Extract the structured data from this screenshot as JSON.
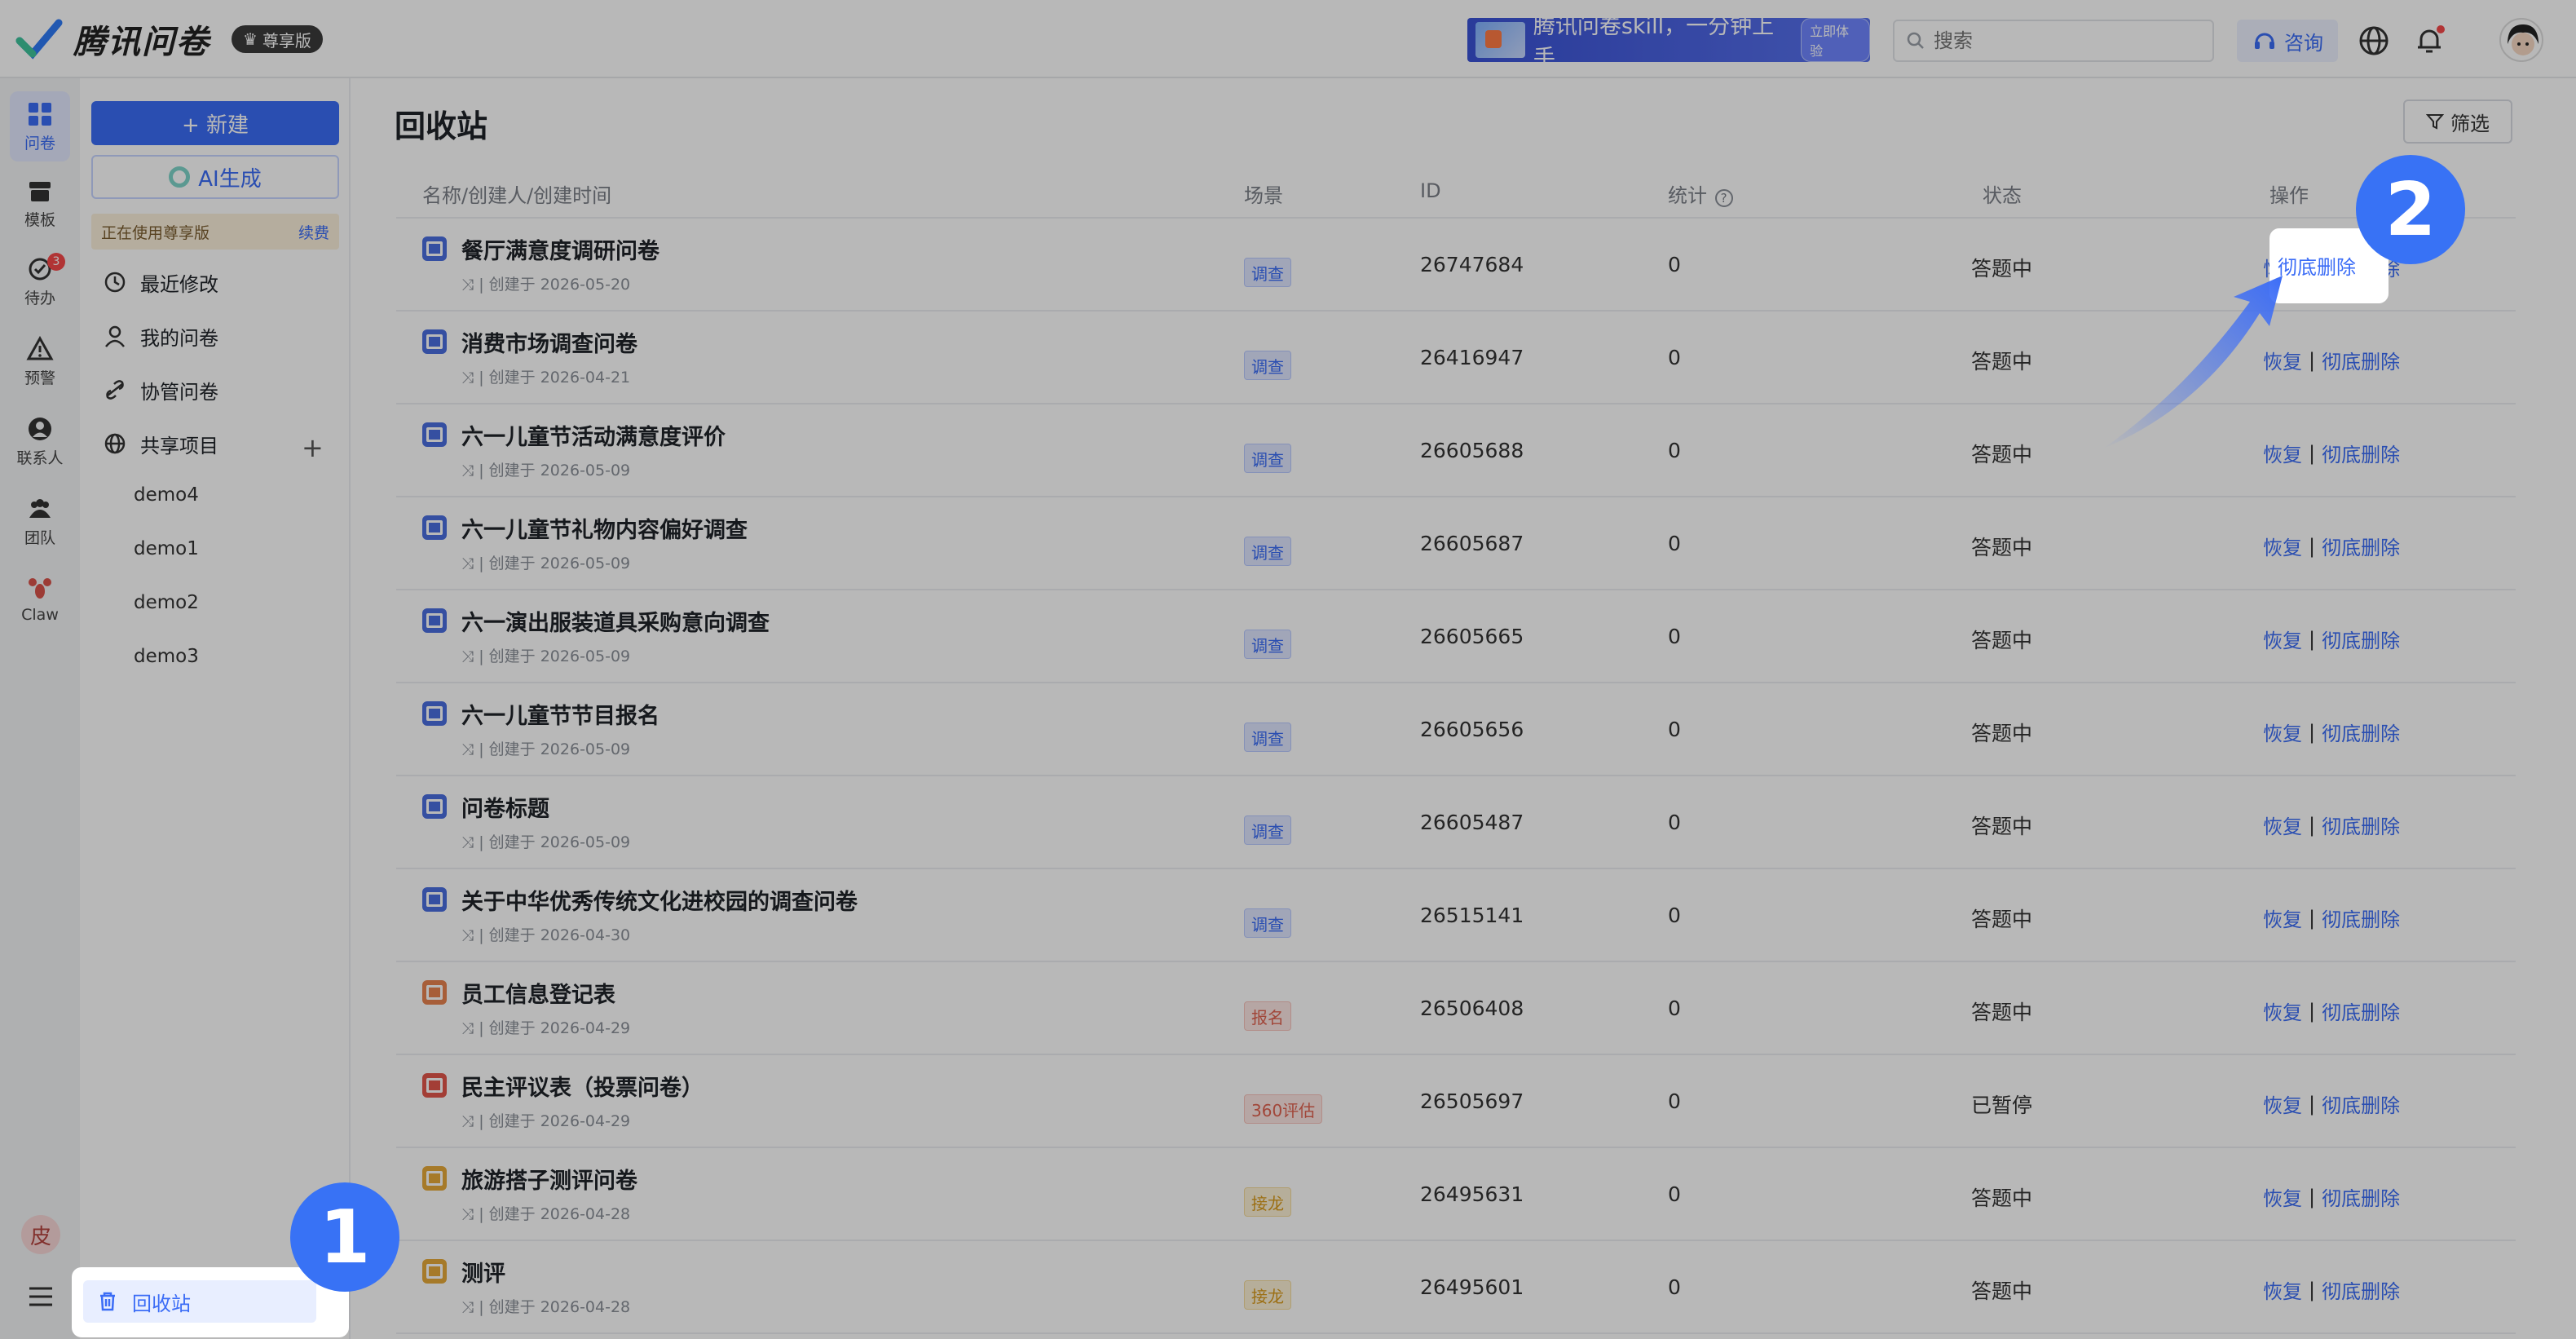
{
  "header": {
    "app_name": "腾讯问卷",
    "vip_badge": "尊享版",
    "promo_text": "腾讯问卷skill，一分钟上手",
    "promo_button": "立即体验",
    "search_placeholder": "搜索",
    "consult_label": "咨询"
  },
  "rail": {
    "items": [
      {
        "label": "问卷",
        "icon": "grid-icon"
      },
      {
        "label": "模板",
        "icon": "template-icon"
      },
      {
        "label": "待办",
        "icon": "check-circle-icon",
        "badge": "3"
      },
      {
        "label": "预警",
        "icon": "warning-icon"
      },
      {
        "label": "联系人",
        "icon": "contact-icon"
      },
      {
        "label": "团队",
        "icon": "team-icon"
      },
      {
        "label": "Claw",
        "icon": "lobster-icon"
      }
    ],
    "user_initial": "皮"
  },
  "leftnav": {
    "new_button": "+ 新建",
    "ai_button": "AI生成",
    "vip_text": "正在使用尊享版",
    "renew": "续费",
    "items": [
      {
        "label": "最近修改"
      },
      {
        "label": "我的问卷"
      },
      {
        "label": "协管问卷"
      },
      {
        "label": "共享项目"
      }
    ],
    "projects": [
      "demo4",
      "demo1",
      "demo2",
      "demo3"
    ],
    "recycle": "回收站"
  },
  "main": {
    "title": "回收站",
    "filter": "筛选",
    "columns": {
      "name": "名称/创建人/创建时间",
      "scene": "场景",
      "id": "ID",
      "stats": "统计",
      "status": "状态",
      "ops": "操作"
    },
    "op_restore": "恢复",
    "op_delete": "彻底删除",
    "rows": [
      {
        "name": "餐厅满意度调研问卷",
        "meta": "⤨ | 创建于 2026-05-20",
        "scene": "调查",
        "scene_type": "survey",
        "id": "26747684",
        "stats": "0",
        "status": "答题中"
      },
      {
        "name": "消费市场调查问卷",
        "meta": "⤨ | 创建于 2026-04-21",
        "scene": "调查",
        "scene_type": "survey",
        "id": "26416947",
        "stats": "0",
        "status": "答题中"
      },
      {
        "name": "六一儿童节活动满意度评价",
        "meta": "⤨ | 创建于 2026-05-09",
        "scene": "调查",
        "scene_type": "survey",
        "id": "26605688",
        "stats": "0",
        "status": "答题中"
      },
      {
        "name": "六一儿童节礼物内容偏好调查",
        "meta": "⤨ | 创建于 2026-05-09",
        "scene": "调查",
        "scene_type": "survey",
        "id": "26605687",
        "stats": "0",
        "status": "答题中"
      },
      {
        "name": "六一演出服装道具采购意向调查",
        "meta": "⤨ | 创建于 2026-05-09",
        "scene": "调查",
        "scene_type": "survey",
        "id": "26605665",
        "stats": "0",
        "status": "答题中"
      },
      {
        "name": "六一儿童节节目报名",
        "meta": "⤨ | 创建于 2026-05-09",
        "scene": "调查",
        "scene_type": "survey",
        "id": "26605656",
        "stats": "0",
        "status": "答题中"
      },
      {
        "name": "问卷标题",
        "meta": "⤨ | 创建于 2026-05-09",
        "scene": "调查",
        "scene_type": "survey",
        "id": "26605487",
        "stats": "0",
        "status": "答题中"
      },
      {
        "name": "关于中华优秀传统文化进校园的调查问卷",
        "meta": "⤨ | 创建于 2026-04-30",
        "scene": "调查",
        "scene_type": "survey",
        "id": "26515141",
        "stats": "0",
        "status": "答题中"
      },
      {
        "name": "员工信息登记表",
        "meta": "⤨ | 创建于 2026-04-29",
        "scene": "报名",
        "scene_type": "signup",
        "id": "26506408",
        "stats": "0",
        "status": "答题中"
      },
      {
        "name": "民主评议表（投票问卷）",
        "meta": "⤨ | 创建于 2026-04-29",
        "scene": "360评估",
        "scene_type": "eval",
        "id": "26505697",
        "stats": "0",
        "status": "已暂停"
      },
      {
        "name": "旅游搭子测评问卷",
        "meta": "⤨ | 创建于 2026-04-28",
        "scene": "接龙",
        "scene_type": "relay",
        "id": "26495631",
        "stats": "0",
        "status": "答题中"
      },
      {
        "name": "测评",
        "meta": "⤨ | 创建于 2026-04-28",
        "scene": "接龙",
        "scene_type": "relay",
        "id": "26495601",
        "stats": "0",
        "status": "答题中"
      }
    ]
  },
  "annotations": {
    "step1": "1",
    "step2": "2"
  },
  "colors": {
    "accent": "#3b6cf6",
    "survey_icon": "#4a6ee0",
    "signup_icon": "#e8834f",
    "eval_icon": "#e2574c",
    "relay_icon": "#e6a93a"
  }
}
